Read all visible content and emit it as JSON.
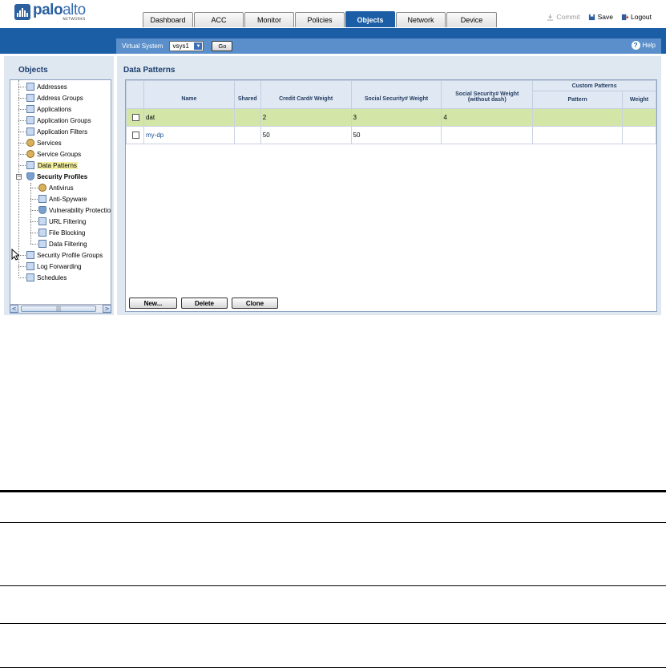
{
  "header": {
    "logo_name_a": "palo",
    "logo_name_b": "alto",
    "logo_sub": "NETWORKS",
    "tabs": [
      {
        "label": "Dashboard",
        "active": false
      },
      {
        "label": "ACC",
        "active": false
      },
      {
        "label": "Monitor",
        "active": false
      },
      {
        "label": "Policies",
        "active": false
      },
      {
        "label": "Objects",
        "active": true
      },
      {
        "label": "Network",
        "active": false
      },
      {
        "label": "Device",
        "active": false
      }
    ],
    "actions": {
      "commit": "Commit",
      "save": "Save",
      "logout": "Logout"
    }
  },
  "toolbar": {
    "virtual_system_label": "Virtual System",
    "vsys_value": "vsys1",
    "go_label": "Go",
    "help_label": "Help"
  },
  "sidebar": {
    "title": "Objects",
    "items": [
      {
        "label": "Addresses"
      },
      {
        "label": "Address Groups"
      },
      {
        "label": "Applications"
      },
      {
        "label": "Application Groups"
      },
      {
        "label": "Application Filters"
      },
      {
        "label": "Services"
      },
      {
        "label": "Service Groups"
      },
      {
        "label": "Data Patterns",
        "selected": true
      },
      {
        "label": "Security Profiles"
      },
      {
        "label": "Antivirus"
      },
      {
        "label": "Anti-Spyware"
      },
      {
        "label": "Vulnerability Protection"
      },
      {
        "label": "URL Filtering"
      },
      {
        "label": "File Blocking"
      },
      {
        "label": "Data Filtering"
      },
      {
        "label": "Security Profile Groups"
      },
      {
        "label": "Log Forwarding"
      },
      {
        "label": "Schedules"
      }
    ],
    "scroll_left": "<",
    "scroll_right": ">",
    "scroll_grip": "|||"
  },
  "main": {
    "title": "Data Patterns",
    "columns": {
      "name": "Name",
      "shared": "Shared",
      "cc": "Credit Card# Weight",
      "ssn": "Social Security# Weight",
      "ssn_nodash_1": "Social Security# Weight",
      "ssn_nodash_2": "(without dash)",
      "custom_group": "Custom Patterns",
      "pattern": "Pattern",
      "weight": "Weight"
    },
    "rows": [
      {
        "name": "dat",
        "shared": "",
        "cc": "2",
        "ssn": "3",
        "ssn_nodash": "4",
        "pattern": "",
        "weight": ""
      },
      {
        "name": "my-dp",
        "shared": "",
        "cc": "50",
        "ssn": "50",
        "ssn_nodash": "",
        "pattern": "",
        "weight": ""
      }
    ],
    "buttons": {
      "new": "New...",
      "delete": "Delete",
      "clone": "Clone"
    }
  },
  "colors": {
    "band_blue": "#1c5ea6",
    "toolbar_blue": "#5a8fcb",
    "selected_row": "#d3e6a8",
    "panel_bg": "#dfe7f1"
  }
}
